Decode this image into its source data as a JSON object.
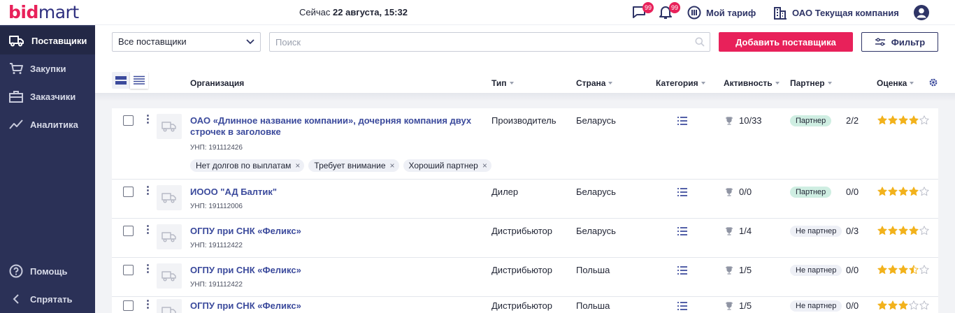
{
  "header": {
    "logo_bid": "bid",
    "logo_mart": "mart",
    "now_prefix": "Сейчас",
    "now_value": "22 августа, 15:32",
    "messages_badge": "99",
    "notifications_badge": "99",
    "tariff_label": "Мой тариф",
    "company_label": "ОАО Текущая компания"
  },
  "sidebar": {
    "items": [
      {
        "label": "Поставщики",
        "icon": "truck-icon",
        "active": true
      },
      {
        "label": "Закупки",
        "icon": "cart-icon"
      },
      {
        "label": "Заказчики",
        "icon": "briefcase-icon"
      },
      {
        "label": "Аналитика",
        "icon": "chart-line-icon"
      }
    ],
    "help_label": "Помощь",
    "hide_label": "Спрятать"
  },
  "toolbar": {
    "supplier_select": "Все поставщики",
    "search_placeholder": "Поиск",
    "add_label": "Добавить поставщика",
    "filter_label": "Фильтр"
  },
  "columns": {
    "organization": "Организация",
    "type": "Тип",
    "country": "Страна",
    "category": "Категория",
    "activity": "Активность",
    "partner": "Партнер",
    "rating": "Оценка"
  },
  "rows": [
    {
      "org": "ОАО «Длинное название компании», дочерняя компания двух строчек в заголовке",
      "unp": "УНП: 191112426",
      "type": "Производитель",
      "country": "Беларусь",
      "activity": "10/33",
      "partner": "Партнер",
      "partner_count": "2/2",
      "rating": 4,
      "tags": [
        "Нет долгов по выплатам",
        "Требует внимание",
        "Хороший партнер"
      ]
    },
    {
      "org": "ИООО \"АД Балтик\"",
      "unp": "УНП: 191112006",
      "type": "Дилер",
      "country": "Беларусь",
      "activity": "0/0",
      "partner": "Партнер",
      "partner_count": "0/0",
      "rating": 4
    },
    {
      "org": "ОГПУ при СНК «Феликс»",
      "unp": "УНП: 191112422",
      "type": "Дистрибьютор",
      "country": "Беларусь",
      "activity": "1/4",
      "partner": "Не партнер",
      "partner_count": "0/3",
      "rating": 4
    },
    {
      "org": "ОГПУ при СНК «Феликс»",
      "unp": "УНП: 191112422",
      "type": "Дистрибьютор",
      "country": "Польша",
      "activity": "1/5",
      "partner": "Не партнер",
      "partner_count": "0/0",
      "rating": 3.5
    },
    {
      "org": "ОГПУ при СНК «Феликс»",
      "unp": "",
      "type": "Дистрибьютор",
      "country": "Польша",
      "activity": "1/5",
      "partner": "Не партнер",
      "partner_count": "0/0",
      "rating": 3
    }
  ],
  "colors": {
    "brand_pink": "#e8215a",
    "brand_navy": "#2e3466",
    "sidebar_bg": "#2b3157",
    "link_blue": "#3b4a9c",
    "star_gold": "#f2b21c",
    "partner_green": "#cfeee2"
  }
}
